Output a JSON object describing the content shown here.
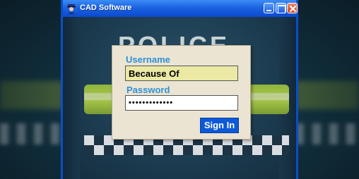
{
  "window": {
    "title": "CAD Software",
    "icon": "police-officer-icon"
  },
  "background_art": {
    "jacket_text": "POLICE"
  },
  "login": {
    "username_label": "Username",
    "username_value": "Because Of",
    "password_label": "Password",
    "password_value": "•••••••••••••",
    "signin_label": "Sign In"
  },
  "colors": {
    "titlebar": "#1b62e0",
    "dialog_bg": "#ebe4d3",
    "label": "#2f8fd6",
    "username_field_bg": "#ece9a5",
    "signin_button": "#0d59d8"
  }
}
